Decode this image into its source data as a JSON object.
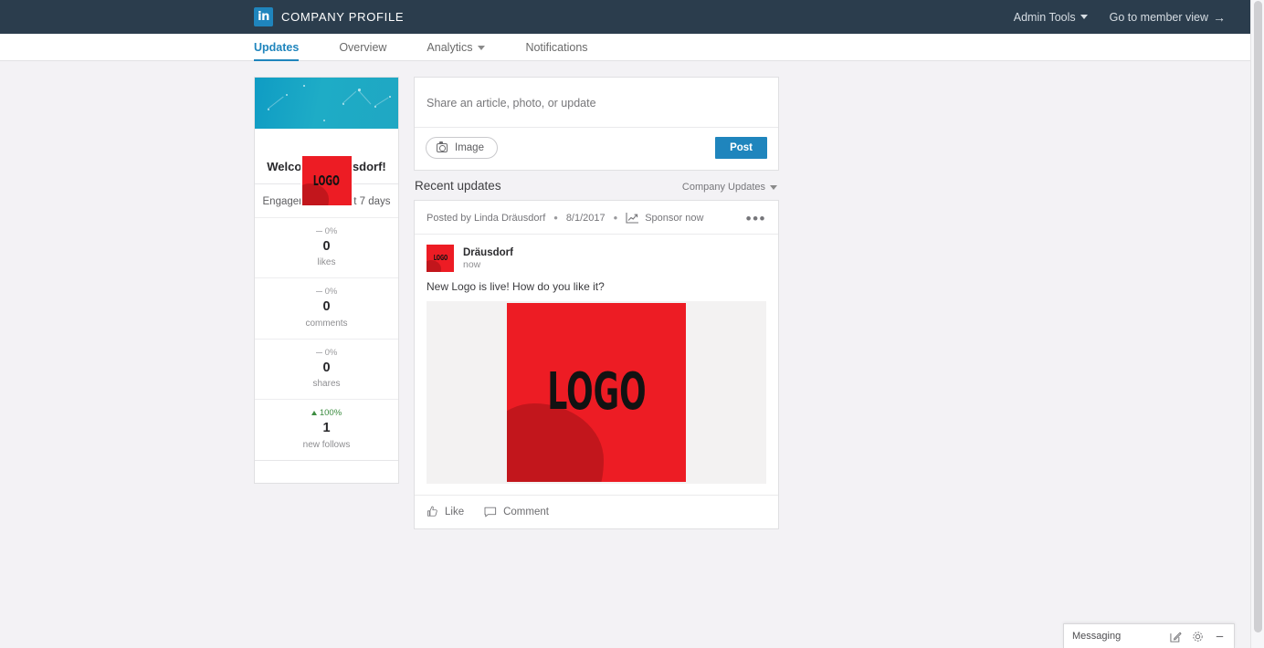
{
  "topbar": {
    "logo_text": "in",
    "title": "COMPANY PROFILE",
    "admin_tools": "Admin Tools",
    "member_view": "Go to member view",
    "arrow": "→"
  },
  "nav": {
    "items": [
      {
        "label": "Updates",
        "active": true,
        "caret": false
      },
      {
        "label": "Overview",
        "active": false,
        "caret": false
      },
      {
        "label": "Analytics",
        "active": false,
        "caret": true
      },
      {
        "label": "Notifications",
        "active": false,
        "caret": false
      }
    ]
  },
  "profile_card": {
    "logo_text": "LOGO",
    "welcome": "Welcome, Dräusdorf!",
    "engagement_header": "Engagement for last 7 days",
    "stats": [
      {
        "pct": "0%",
        "direction": "flat",
        "value": "0",
        "label": "likes"
      },
      {
        "pct": "0%",
        "direction": "flat",
        "value": "0",
        "label": "comments"
      },
      {
        "pct": "0%",
        "direction": "flat",
        "value": "0",
        "label": "shares"
      },
      {
        "pct": "100%",
        "direction": "up",
        "value": "1",
        "label": "new follows"
      }
    ]
  },
  "share": {
    "placeholder": "Share an article, photo, or update",
    "image_button": "Image",
    "post_button": "Post"
  },
  "recent": {
    "title": "Recent updates",
    "filter": "Company Updates"
  },
  "post": {
    "posted_by": "Posted by Linda Dräusdorf",
    "date": "8/1/2017",
    "sponsor": "Sponsor now",
    "more": "•••",
    "separator": "•",
    "author": "Dräusdorf",
    "time": "now",
    "text": "New Logo is live! How do you like it?",
    "image_text": "LOGO",
    "like": "Like",
    "comment": "Comment"
  },
  "messaging": {
    "title": "Messaging"
  },
  "colors": {
    "topbar": "#2b3d4d",
    "accent": "#1f85bd",
    "banner_teal": "#1aa3c4",
    "logo_red": "#ed1c24",
    "up_green": "#3c8c40",
    "page_bg": "#f3f2f5"
  }
}
